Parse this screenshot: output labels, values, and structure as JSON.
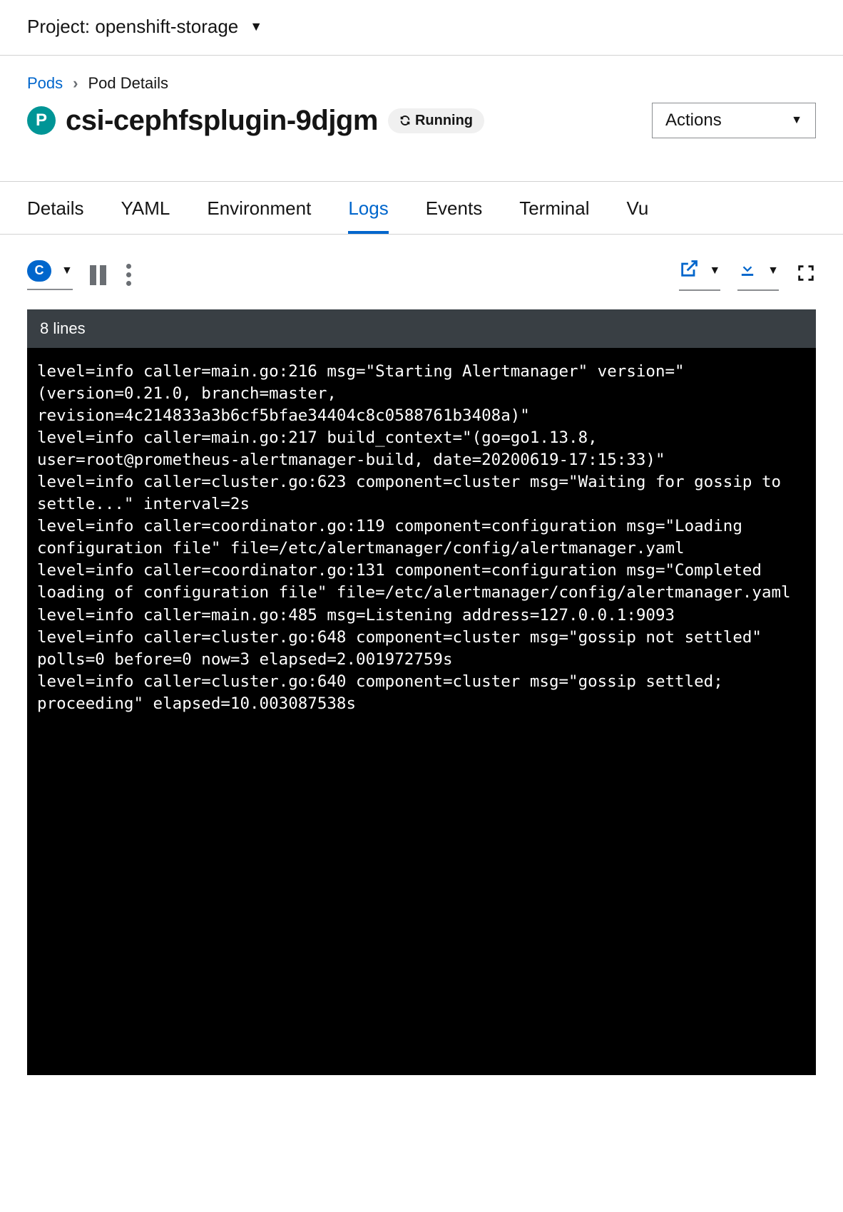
{
  "project_bar": {
    "label": "Project: openshift-storage"
  },
  "breadcrumb": {
    "root": "Pods",
    "current": "Pod Details"
  },
  "pod": {
    "badge_letter": "P",
    "name": "csi-cephfsplugin-9djgm",
    "status": "Running"
  },
  "actions": {
    "label": "Actions"
  },
  "tabs": {
    "items": [
      "Details",
      "YAML",
      "Environment",
      "Logs",
      "Events",
      "Terminal",
      "Vu"
    ],
    "active_index": 3
  },
  "toolbar": {
    "container_chip": "C",
    "lines_label": "8 lines"
  },
  "log_lines": [
    "level=info caller=main.go:216 msg=\"Starting Alertmanager\" version=\"(version=0.21.0, branch=master, revision=4c214833a3b6cf5bfae34404c8c0588761b3408a)\"",
    "level=info caller=main.go:217 build_context=\"(go=go1.13.8, user=root@prometheus-alertmanager-build, date=20200619-17:15:33)\"",
    "level=info caller=cluster.go:623 component=cluster msg=\"Waiting for gossip to settle...\" interval=2s",
    "level=info caller=coordinator.go:119 component=configuration msg=\"Loading configuration file\" file=/etc/alertmanager/config/alertmanager.yaml",
    "level=info caller=coordinator.go:131 component=configuration msg=\"Completed loading of configuration file\" file=/etc/alertmanager/config/alertmanager.yaml",
    "level=info caller=main.go:485 msg=Listening address=127.0.0.1:9093",
    "level=info caller=cluster.go:648 component=cluster msg=\"gossip not settled\" polls=0 before=0 now=3 elapsed=2.001972759s",
    "level=info caller=cluster.go:640 component=cluster msg=\"gossip settled; proceeding\" elapsed=10.003087538s"
  ]
}
